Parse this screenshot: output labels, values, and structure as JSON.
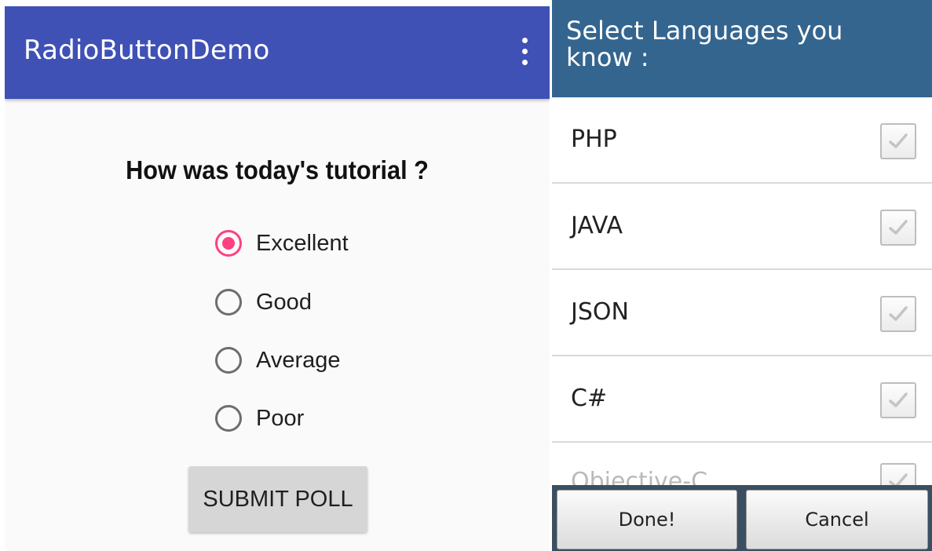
{
  "left_app": {
    "title": "RadioButtonDemo",
    "menu_icon": "overflow-menu-icon",
    "question": "How was today's tutorial ?",
    "options": [
      {
        "label": "Excellent",
        "checked": true
      },
      {
        "label": "Good",
        "checked": false
      },
      {
        "label": "Average",
        "checked": false
      },
      {
        "label": "Poor",
        "checked": false
      }
    ],
    "submit_label": "SUBMIT POLL",
    "colors": {
      "app_bar": "#3f51b5",
      "accent": "#ff4081",
      "button": "#d6d6d6"
    }
  },
  "dialog": {
    "title": "Select Languages you know :",
    "items": [
      {
        "label": "PHP",
        "checked": true
      },
      {
        "label": "JAVA",
        "checked": true
      },
      {
        "label": "JSON",
        "checked": true
      },
      {
        "label": "C#",
        "checked": true
      },
      {
        "label": "Objective-C",
        "checked": true
      }
    ],
    "buttons": {
      "done": "Done!",
      "cancel": "Cancel"
    },
    "colors": {
      "header": "#34658f",
      "button_bar": "#3a4f61",
      "check": "#c4c4c4"
    }
  }
}
